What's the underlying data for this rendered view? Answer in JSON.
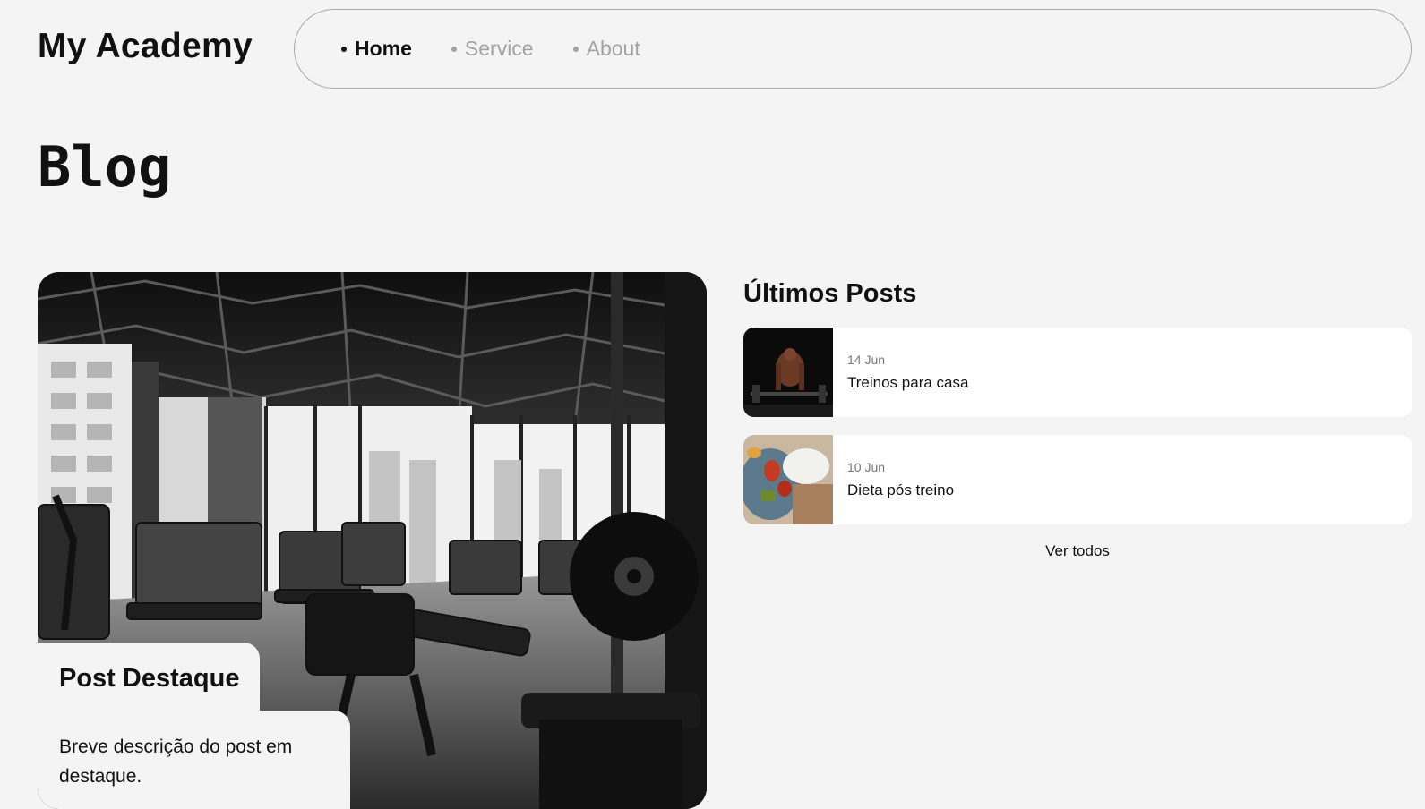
{
  "header": {
    "logo": "My Academy",
    "nav": [
      {
        "label": "Home",
        "active": true
      },
      {
        "label": "Service",
        "active": false
      },
      {
        "label": "About",
        "active": false
      }
    ]
  },
  "page": {
    "title": "Blog"
  },
  "featured": {
    "title": "Post Destaque",
    "description": "Breve descrição do post em destaque.",
    "image": "gym-interior-photo"
  },
  "latest": {
    "title": "Últimos Posts",
    "posts": [
      {
        "date": "14 Jun",
        "title": "Treinos para casa",
        "image": "workout-photo"
      },
      {
        "date": "10 Jun",
        "title": "Dieta pós treino",
        "image": "food-photo"
      }
    ],
    "see_all": "Ver todos"
  },
  "colors": {
    "background": "#f4f4f4",
    "text": "#111111",
    "nav_inactive": "#a3a3a3",
    "card": "#ffffff"
  }
}
